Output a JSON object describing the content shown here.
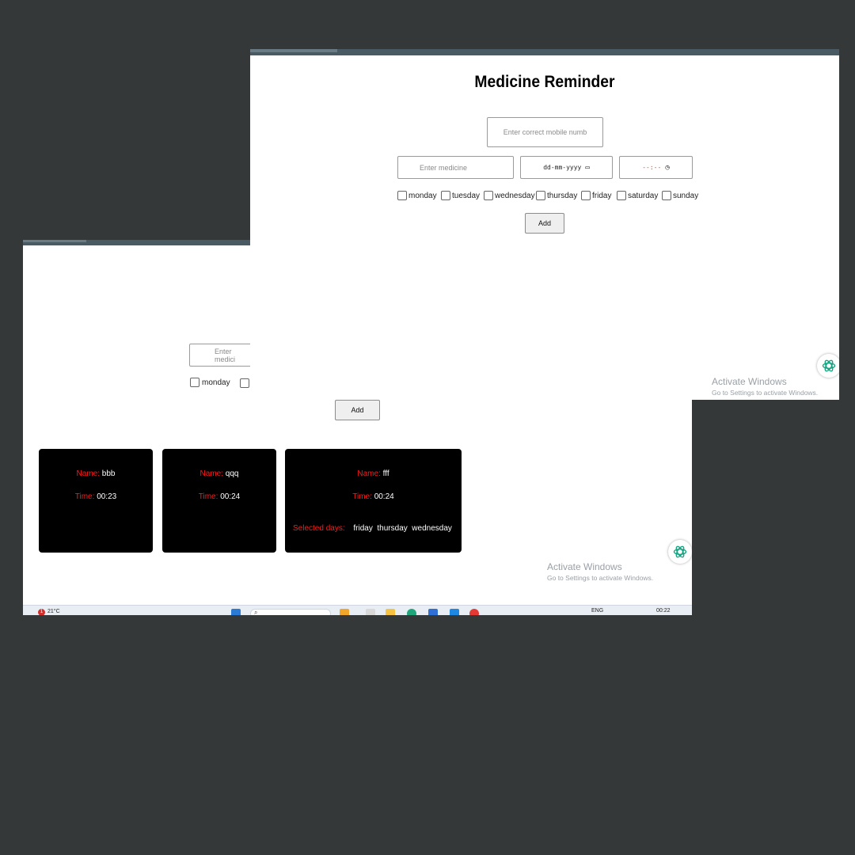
{
  "back_window": {
    "medicine_placeholder": "Enter medici",
    "first_day": "monday",
    "add_label": "Add",
    "cards": [
      {
        "name_label": "Name:",
        "name": "bbb",
        "time_label": "Time:",
        "time": "00:23"
      },
      {
        "name_label": "Name:",
        "name": "qqq",
        "time_label": "Time:",
        "time": "00:24"
      },
      {
        "name_label": "Name:",
        "name": "fff",
        "time_label": "Time:",
        "time": "00:24",
        "days_label": "Selected days:",
        "days": "friday  thursday  wednesday"
      }
    ],
    "activate": {
      "line1": "Activate Windows",
      "line2": "Go to Settings to activate Windows."
    },
    "taskbar": {
      "weather_badge": "1",
      "temperature": "21°C",
      "language": "ENG",
      "clock": "00:22"
    }
  },
  "front_window": {
    "title": "Medicine Reminder",
    "mobile_placeholder": "Enter correct mobile numb",
    "medicine_placeholder": "Enter medicine",
    "date_placeholder": "dd-mm-yyyy",
    "time_placeholder": "--:--",
    "days": [
      "monday",
      "tuesday",
      "wednesday",
      "thursday",
      "friday",
      "saturday",
      "sunday"
    ],
    "add_label": "Add",
    "activate": {
      "line1": "Activate Windows",
      "line2": "Go to Settings to activate Windows."
    }
  },
  "colors": {
    "backdrop": "#343838",
    "card_background": "#000000",
    "label_red": "#ff1a1a",
    "chatgpt_green": "#10a37f"
  },
  "icons": [
    "calendar-icon",
    "clock-icon",
    "chatgpt-icon",
    "windows-start-icon",
    "search-icon"
  ]
}
